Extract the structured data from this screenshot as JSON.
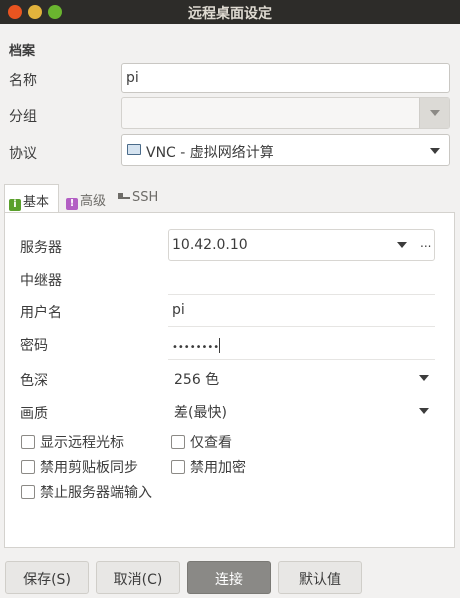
{
  "window": {
    "title": "远程桌面设定"
  },
  "profile": {
    "section": "档案",
    "name_label": "名称",
    "name_value": "pi",
    "group_label": "分组",
    "group_value": "",
    "protocol_label": "协议",
    "protocol_value": "VNC - 虚拟网络计算"
  },
  "tabs": [
    {
      "label": "基本",
      "icon": "info-icon"
    },
    {
      "label": "高级",
      "icon": "advanced-icon"
    },
    {
      "label": "SSH",
      "icon": "key-icon"
    }
  ],
  "basic": {
    "server_label": "服务器",
    "server_value": "10.42.0.10",
    "server_more": "...",
    "repeater_label": "中继器",
    "repeater_value": "",
    "username_label": "用户名",
    "username_value": "pi",
    "password_label": "密码",
    "password_value": "••••••••",
    "color_label": "色深",
    "color_value": "256 色",
    "quality_label": "画质",
    "quality_value": "差(最快)"
  },
  "checkboxes": [
    {
      "label": "显示远程光标",
      "checked": false
    },
    {
      "label": "仅查看",
      "checked": false
    },
    {
      "label": "禁用剪贴板同步",
      "checked": false
    },
    {
      "label": "禁用加密",
      "checked": false
    },
    {
      "label": "禁止服务器端输入",
      "checked": false
    }
  ],
  "buttons": {
    "save": "保存(S)",
    "cancel": "取消(C)",
    "connect": "连接",
    "default": "默认值"
  },
  "colors": {
    "accent": "#e95420",
    "titlebar": "#2d2c29"
  }
}
